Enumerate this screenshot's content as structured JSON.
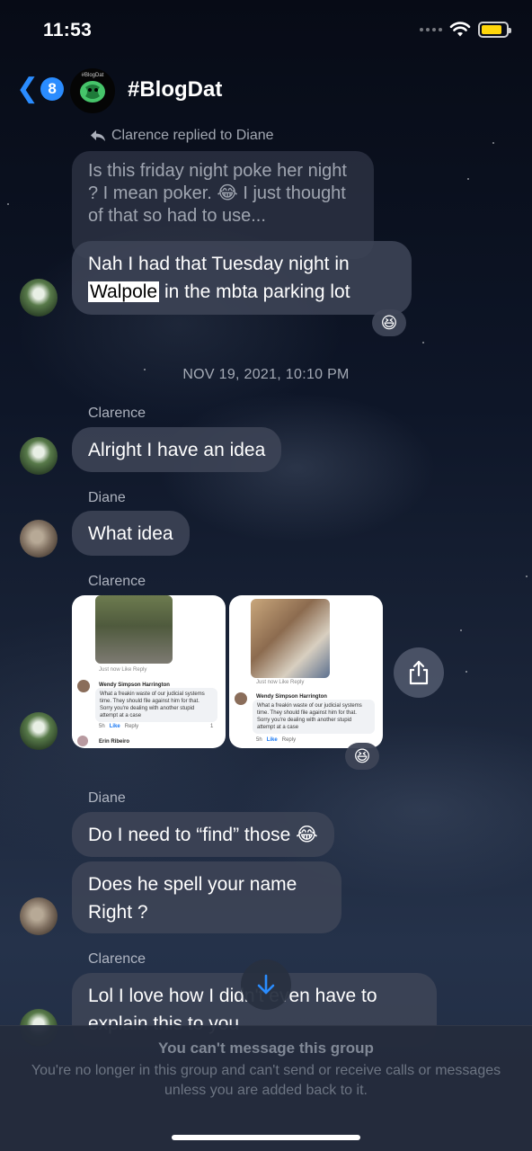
{
  "status_bar": {
    "time": "11:53"
  },
  "header": {
    "back_count": "8",
    "group_name": "#BlogDat",
    "avatar_text": "#BlogDat"
  },
  "messages": {
    "reply_hint": "Clarence replied to Diane",
    "quoted_text": "Is this friday night poke her night ? I mean poker. 😂 I just thought of that so had to use...",
    "reply_text_before": "Nah I had that Tuesday night in",
    "reply_text_highlight": "Walpole",
    "reply_text_after": "in the mbta parking lot",
    "reaction_1": "😆",
    "date_separator": "NOV 19, 2021, 10:10 PM",
    "sender_1": "Clarence",
    "msg_1": "Alright I have an idea",
    "sender_2": "Diane",
    "msg_2": "What idea",
    "sender_3": "Clarence",
    "reaction_2": "😆",
    "sender_4": "Diane",
    "msg_4a": "Do I need to “find” those 😂",
    "msg_4b_line1": "Does he spell your name",
    "msg_4b_line2": "Right ?",
    "sender_5": "Clarence",
    "msg_5_line1": "Lol I love how I didn't even have to",
    "msg_5_line2": "explain this to you"
  },
  "image_1": {
    "meta": "Just now   Like   Reply",
    "commenter": "Wendy Simpson Harrington",
    "comment": "What a freakin waste of our judicial systems time.  They should file against him for that.  Sorry you're dealing with another stupid attempt at a case",
    "actions_time": "5h",
    "actions_like": "Like",
    "actions_reply": "Reply",
    "count": "1",
    "second_commenter": "Erin Ribeiro"
  },
  "image_2": {
    "meta": "Just now   Like   Reply",
    "commenter": "Wendy Simpson Harrington",
    "comment": "What a freakin waste of our judicial systems time.  They should file against him for that.  Sorry you're dealing with another stupid attempt at a case",
    "actions_time": "5h",
    "actions_like": "Like",
    "actions_reply": "Reply"
  },
  "footer": {
    "title": "You can't message this group",
    "body": "You're no longer in this group and can't send or receive calls or messages unless you are added back to it."
  },
  "icons": {
    "back": "chevron-left-icon",
    "share": "share-icon",
    "scroll_down": "arrow-down-icon",
    "reply": "reply-arrow-icon",
    "wifi": "wifi-icon",
    "battery": "battery-icon"
  },
  "colors": {
    "accent": "#2a8cff",
    "bubble": "#3e4456",
    "battery": "#ffd60a"
  }
}
